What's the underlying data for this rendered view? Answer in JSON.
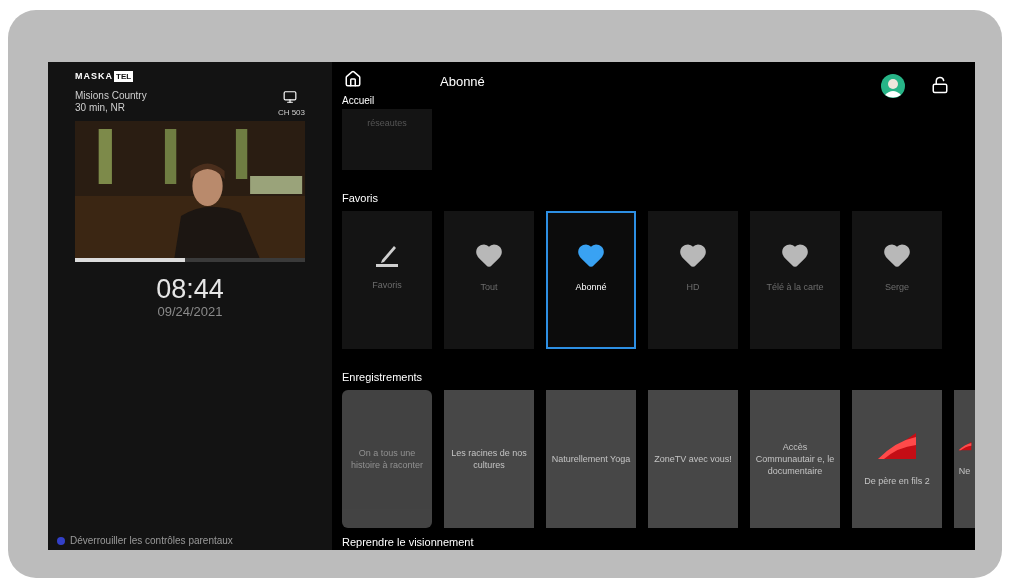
{
  "player": {
    "logo": [
      "MASKA",
      "TEL"
    ],
    "program": "Misions Country",
    "details": "30 min, NR",
    "channel": "CH 503",
    "level": 0.48
  },
  "clock": {
    "time": "08:44",
    "date": "09/24/2021"
  },
  "parental": {
    "label": "Déverrouiller les contrôles parentaux"
  },
  "header": {
    "home": "Accueil",
    "title": "Abonné"
  },
  "top_tile": {
    "label": "réseautes"
  },
  "favorites": {
    "title": "Favoris",
    "items": [
      {
        "kind": "edit",
        "label": "Favoris",
        "selected": false
      },
      {
        "kind": "heart",
        "label": "Tout",
        "selected": false
      },
      {
        "kind": "heart",
        "label": "Abonné",
        "selected": true
      },
      {
        "kind": "heart",
        "label": "HD",
        "selected": false
      },
      {
        "kind": "heart",
        "label": "Télé à la carte",
        "selected": false
      },
      {
        "kind": "heart",
        "label": "Serge",
        "selected": false
      }
    ]
  },
  "recordings": {
    "title": "Enregistrements",
    "items": [
      {
        "kind": "text",
        "label": "On a tous une histoire à raconter",
        "disabled": true
      },
      {
        "kind": "text",
        "label": "Les racines de nos cultures",
        "disabled": false
      },
      {
        "kind": "text",
        "label": "Naturellement Yoga",
        "disabled": false
      },
      {
        "kind": "text",
        "label": "ZoneTV avec vous!",
        "disabled": false
      },
      {
        "kind": "text",
        "label": "Accès Communautair e, le documentaire",
        "disabled": false
      },
      {
        "kind": "logo",
        "label": "De père en fils 2",
        "disabled": false
      },
      {
        "kind": "logo",
        "label": "Ne",
        "disabled": false
      }
    ]
  },
  "resume": {
    "title": "Reprendre le visionnement"
  }
}
